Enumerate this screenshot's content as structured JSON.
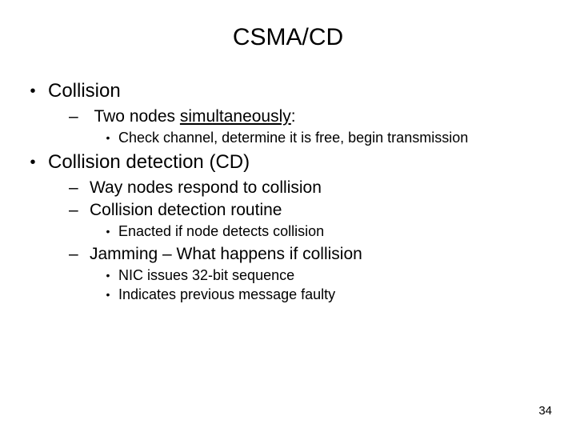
{
  "title": "CSMA/CD",
  "page_number": "34",
  "bullets": [
    {
      "text": "Collision",
      "children": [
        {
          "text_prefix": "Two nodes ",
          "text_underlined": "simultaneously",
          "text_suffix": ":",
          "children": [
            {
              "text": "Check channel, determine it is free, begin transmission"
            }
          ]
        }
      ]
    },
    {
      "text": "Collision detection (CD)",
      "children": [
        {
          "text": "Way nodes respond to collision"
        },
        {
          "text": "Collision detection routine",
          "children": [
            {
              "text": "Enacted if node detects collision"
            }
          ]
        },
        {
          "text": "Jamming – What happens if collision",
          "children": [
            {
              "text": "NIC issues 32-bit sequence"
            },
            {
              "text": "Indicates previous message faulty"
            }
          ]
        }
      ]
    }
  ]
}
